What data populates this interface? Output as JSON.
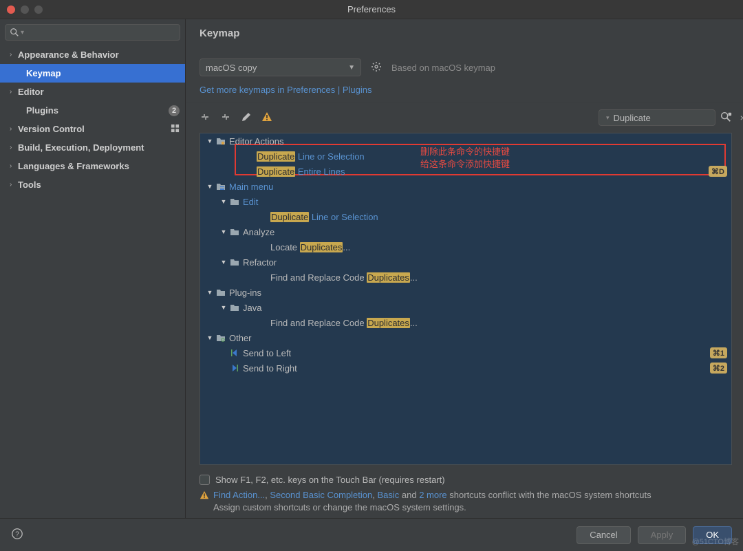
{
  "window": {
    "title": "Preferences"
  },
  "sidebar": {
    "search_placeholder": "",
    "items": [
      {
        "label": "Appearance & Behavior",
        "expandable": true,
        "bold": true
      },
      {
        "label": "Keymap",
        "selected": true,
        "bold": true,
        "child": true
      },
      {
        "label": "Editor",
        "expandable": true,
        "bold": true
      },
      {
        "label": "Plugins",
        "bold": true,
        "child": true,
        "badge": "2"
      },
      {
        "label": "Version Control",
        "expandable": true,
        "bold": true,
        "scope": true
      },
      {
        "label": "Build, Execution, Deployment",
        "expandable": true,
        "bold": true
      },
      {
        "label": "Languages & Frameworks",
        "expandable": true,
        "bold": true
      },
      {
        "label": "Tools",
        "expandable": true,
        "bold": true
      }
    ]
  },
  "keymap": {
    "title": "Keymap",
    "scheme": "macOS copy",
    "based_on": "Based on macOS keymap",
    "more_link": "Get more keymaps in Preferences | Plugins",
    "search_value": "Duplicate",
    "checkbox_label": "Show F1, F2, etc. keys on the Touch Bar (requires restart)",
    "warning": {
      "pre": "",
      "links": [
        "Find Action...",
        "Second Basic Completion",
        "Basic"
      ],
      "mid1": ", ",
      "mid2": ", ",
      "and": " and ",
      "more_link": "2 more",
      "tail": " shortcuts conflict with the macOS system shortcuts",
      "line2": "Assign custom shortcuts or change the macOS system settings."
    },
    "tree": [
      {
        "depth": 0,
        "exp": "open",
        "icon": "folder-star",
        "parts": [
          [
            "plain",
            "Editor Actions"
          ]
        ]
      },
      {
        "depth": 2,
        "icon": "none",
        "parts": [
          [
            "hl",
            "Duplicate"
          ],
          [
            "link",
            " Line or Selection"
          ]
        ]
      },
      {
        "depth": 2,
        "icon": "none",
        "parts": [
          [
            "hl",
            "Duplicate"
          ],
          [
            "link",
            " Entire Lines"
          ]
        ],
        "shortcut": "⌘D"
      },
      {
        "depth": 0,
        "exp": "open",
        "icon": "folder-menu",
        "parts": [
          [
            "link",
            "Main menu"
          ]
        ]
      },
      {
        "depth": 1,
        "exp": "open",
        "icon": "folder",
        "parts": [
          [
            "link",
            "Edit"
          ]
        ]
      },
      {
        "depth": 3,
        "icon": "none",
        "parts": [
          [
            "hl",
            "Duplicate"
          ],
          [
            "link",
            " Line or Selection"
          ]
        ]
      },
      {
        "depth": 1,
        "exp": "open",
        "icon": "folder",
        "parts": [
          [
            "plain",
            "Analyze"
          ]
        ]
      },
      {
        "depth": 3,
        "icon": "none",
        "parts": [
          [
            "plain",
            "Locate "
          ],
          [
            "hl",
            "Duplicates"
          ],
          [
            "plain",
            "..."
          ]
        ]
      },
      {
        "depth": 1,
        "exp": "open",
        "icon": "folder",
        "parts": [
          [
            "plain",
            "Refactor"
          ]
        ]
      },
      {
        "depth": 3,
        "icon": "none",
        "parts": [
          [
            "plain",
            "Find and Replace Code "
          ],
          [
            "hl",
            "Duplicates"
          ],
          [
            "plain",
            "..."
          ]
        ]
      },
      {
        "depth": 0,
        "exp": "open",
        "icon": "folder",
        "parts": [
          [
            "plain",
            "Plug-ins"
          ]
        ]
      },
      {
        "depth": 1,
        "exp": "open",
        "icon": "folder",
        "parts": [
          [
            "plain",
            "Java"
          ]
        ]
      },
      {
        "depth": 3,
        "icon": "none",
        "parts": [
          [
            "plain",
            "Find and Replace Code "
          ],
          [
            "hl",
            "Duplicates"
          ],
          [
            "plain",
            "..."
          ]
        ]
      },
      {
        "depth": 0,
        "exp": "open",
        "icon": "folder-gear",
        "parts": [
          [
            "plain",
            "Other"
          ]
        ]
      },
      {
        "depth": 1,
        "icon": "send-left",
        "parts": [
          [
            "plain",
            "Send to Left"
          ]
        ],
        "shortcut": "⌘1"
      },
      {
        "depth": 1,
        "icon": "send-right",
        "parts": [
          [
            "plain",
            "Send to Right"
          ]
        ],
        "shortcut": "⌘2"
      }
    ],
    "annotation": {
      "line1": "删除此条命令的快捷键",
      "line2": "给这条命令添加快捷键"
    }
  },
  "buttons": {
    "cancel": "Cancel",
    "apply": "Apply",
    "ok": "OK"
  },
  "watermark": "@51CTO博客"
}
